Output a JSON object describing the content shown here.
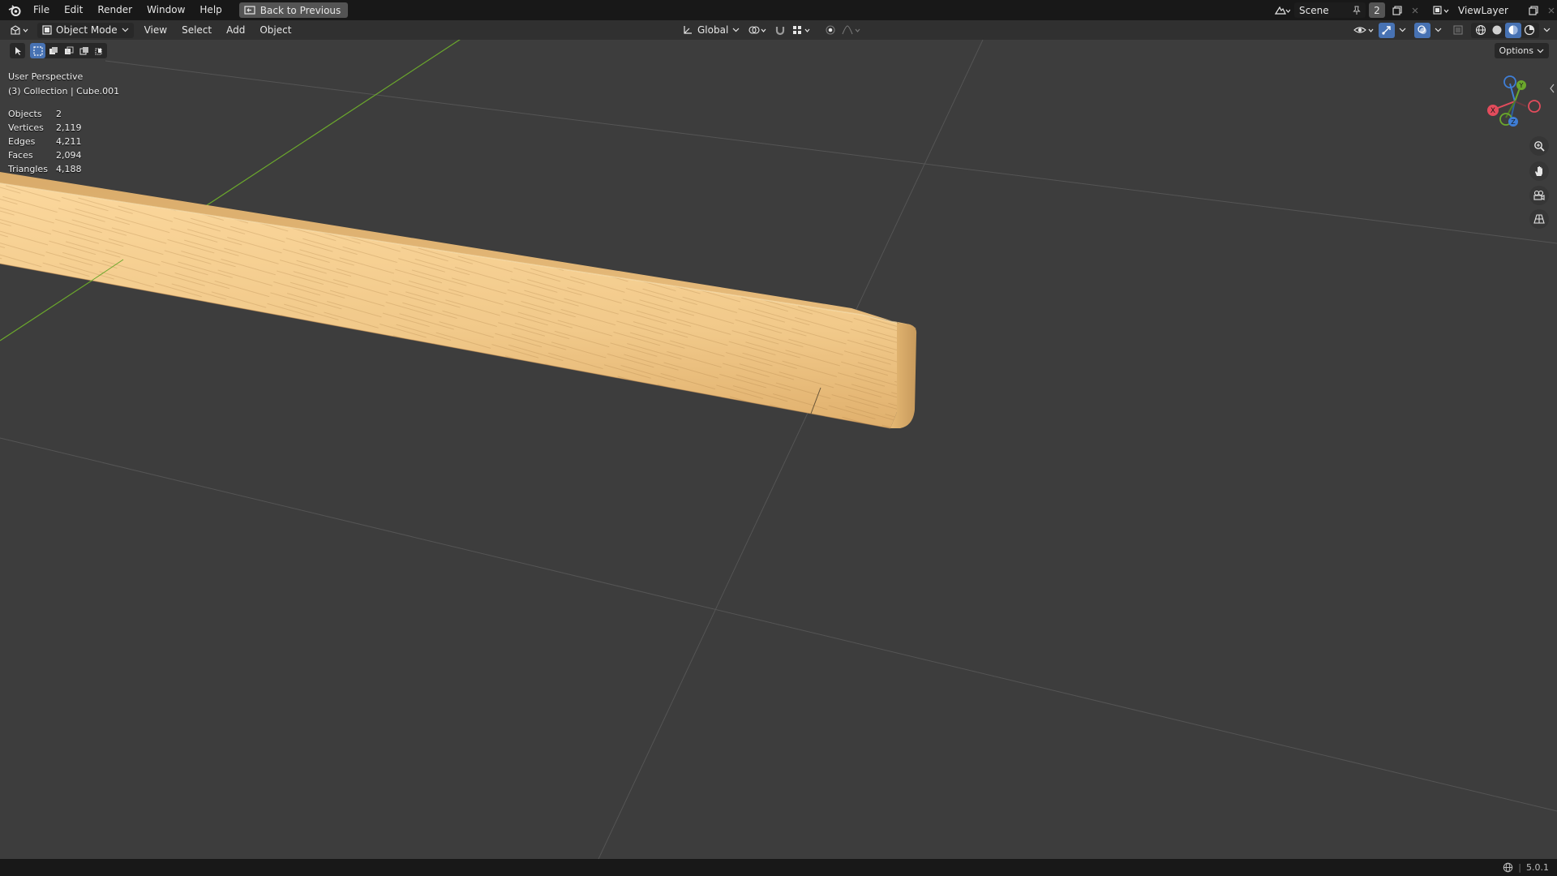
{
  "topbar": {
    "menus": [
      "File",
      "Edit",
      "Render",
      "Window",
      "Help"
    ],
    "back_button": "Back to Previous",
    "scene_name": "Scene",
    "scene_count": "2",
    "view_layer": "ViewLayer"
  },
  "header": {
    "mode": "Object Mode",
    "menus": [
      "View",
      "Select",
      "Add",
      "Object"
    ],
    "transform_orientation": "Global"
  },
  "viewport": {
    "perspective": "User Perspective",
    "collection": "(3) Collection | Cube.001",
    "options": "Options",
    "stats": [
      {
        "label": "Objects",
        "value": "2"
      },
      {
        "label": "Vertices",
        "value": "2,119"
      },
      {
        "label": "Edges",
        "value": "4,211"
      },
      {
        "label": "Faces",
        "value": "2,094"
      },
      {
        "label": "Triangles",
        "value": "4,188"
      }
    ],
    "gizmo": {
      "x_label": "X",
      "y_label": "Y",
      "z_label": "Z"
    }
  },
  "statusbar": {
    "version": "5.0.1"
  },
  "colors": {
    "accent": "#4772b3",
    "axis_x": "#e34c5c",
    "axis_y": "#6ba82c",
    "axis_z": "#3f7ed6",
    "wood_light": "#f1c98a",
    "wood_dark": "#b78a4d"
  }
}
